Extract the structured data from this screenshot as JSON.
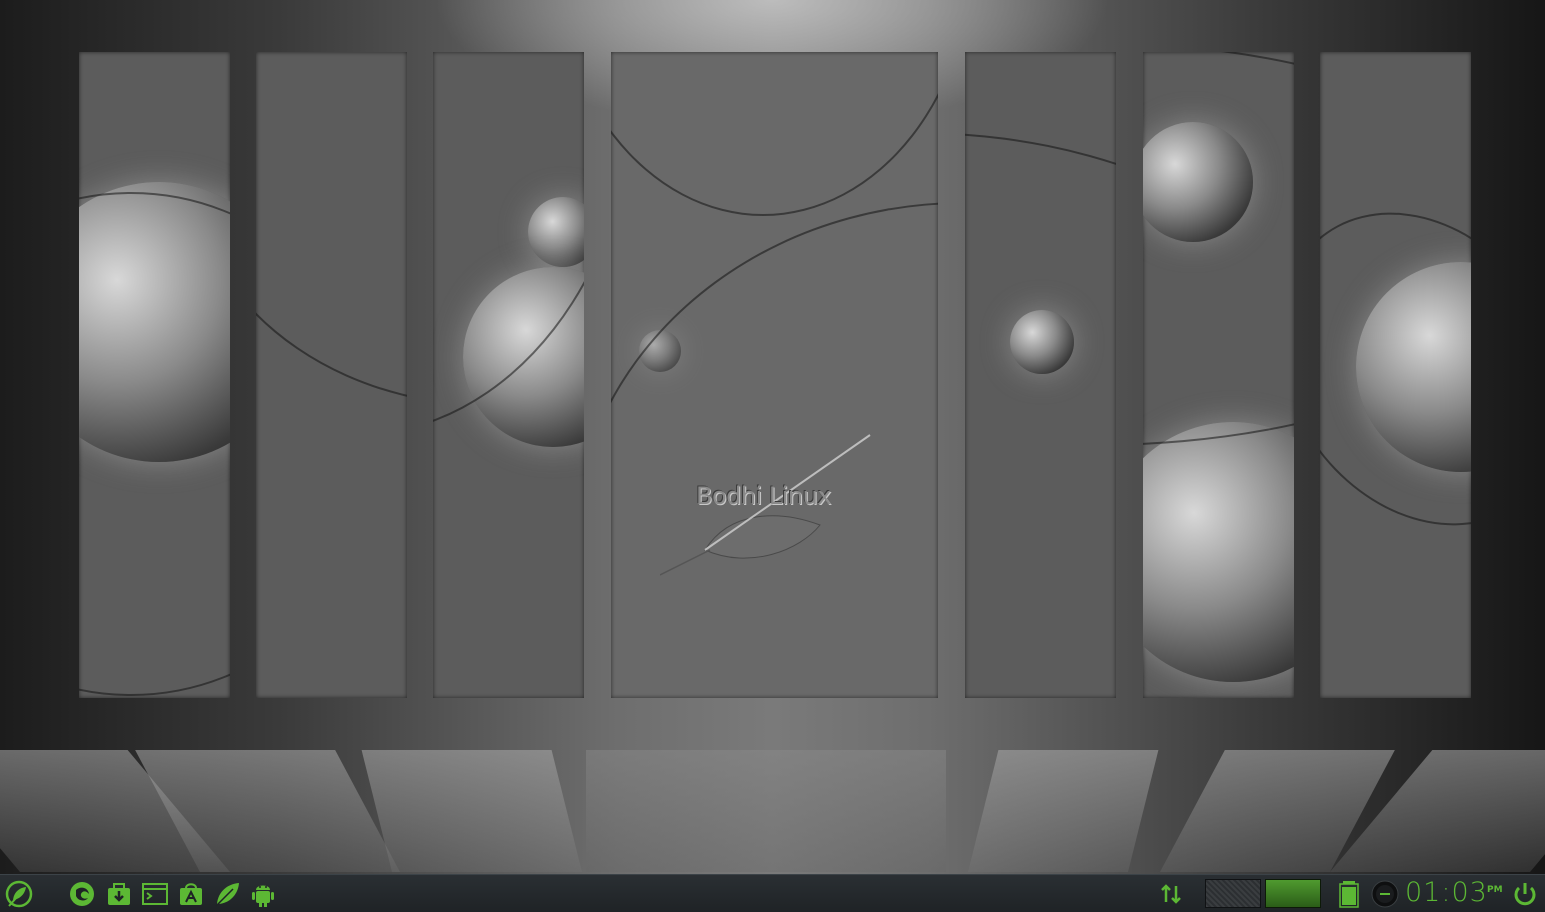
{
  "wallpaper": {
    "watermark_text": "Bodhi Linux"
  },
  "taskbar": {
    "launchers": [
      {
        "name": "menu-leaf-icon"
      },
      {
        "name": "firefox-icon"
      },
      {
        "name": "install-icon"
      },
      {
        "name": "terminal-icon"
      },
      {
        "name": "app-center-icon"
      },
      {
        "name": "leaf-icon"
      },
      {
        "name": "android-icon"
      }
    ],
    "tray": {
      "network_icon": "network-updown-icon",
      "pager_desktops": 2,
      "active_desktop": 2,
      "battery_icon": "battery-icon",
      "mixer_icon": "mixer-knob-icon",
      "power_icon": "power-icon"
    },
    "clock": {
      "time": "01:03",
      "ampm": "PM"
    },
    "accent_color": "#5cb834",
    "background_color": "#23282b"
  }
}
